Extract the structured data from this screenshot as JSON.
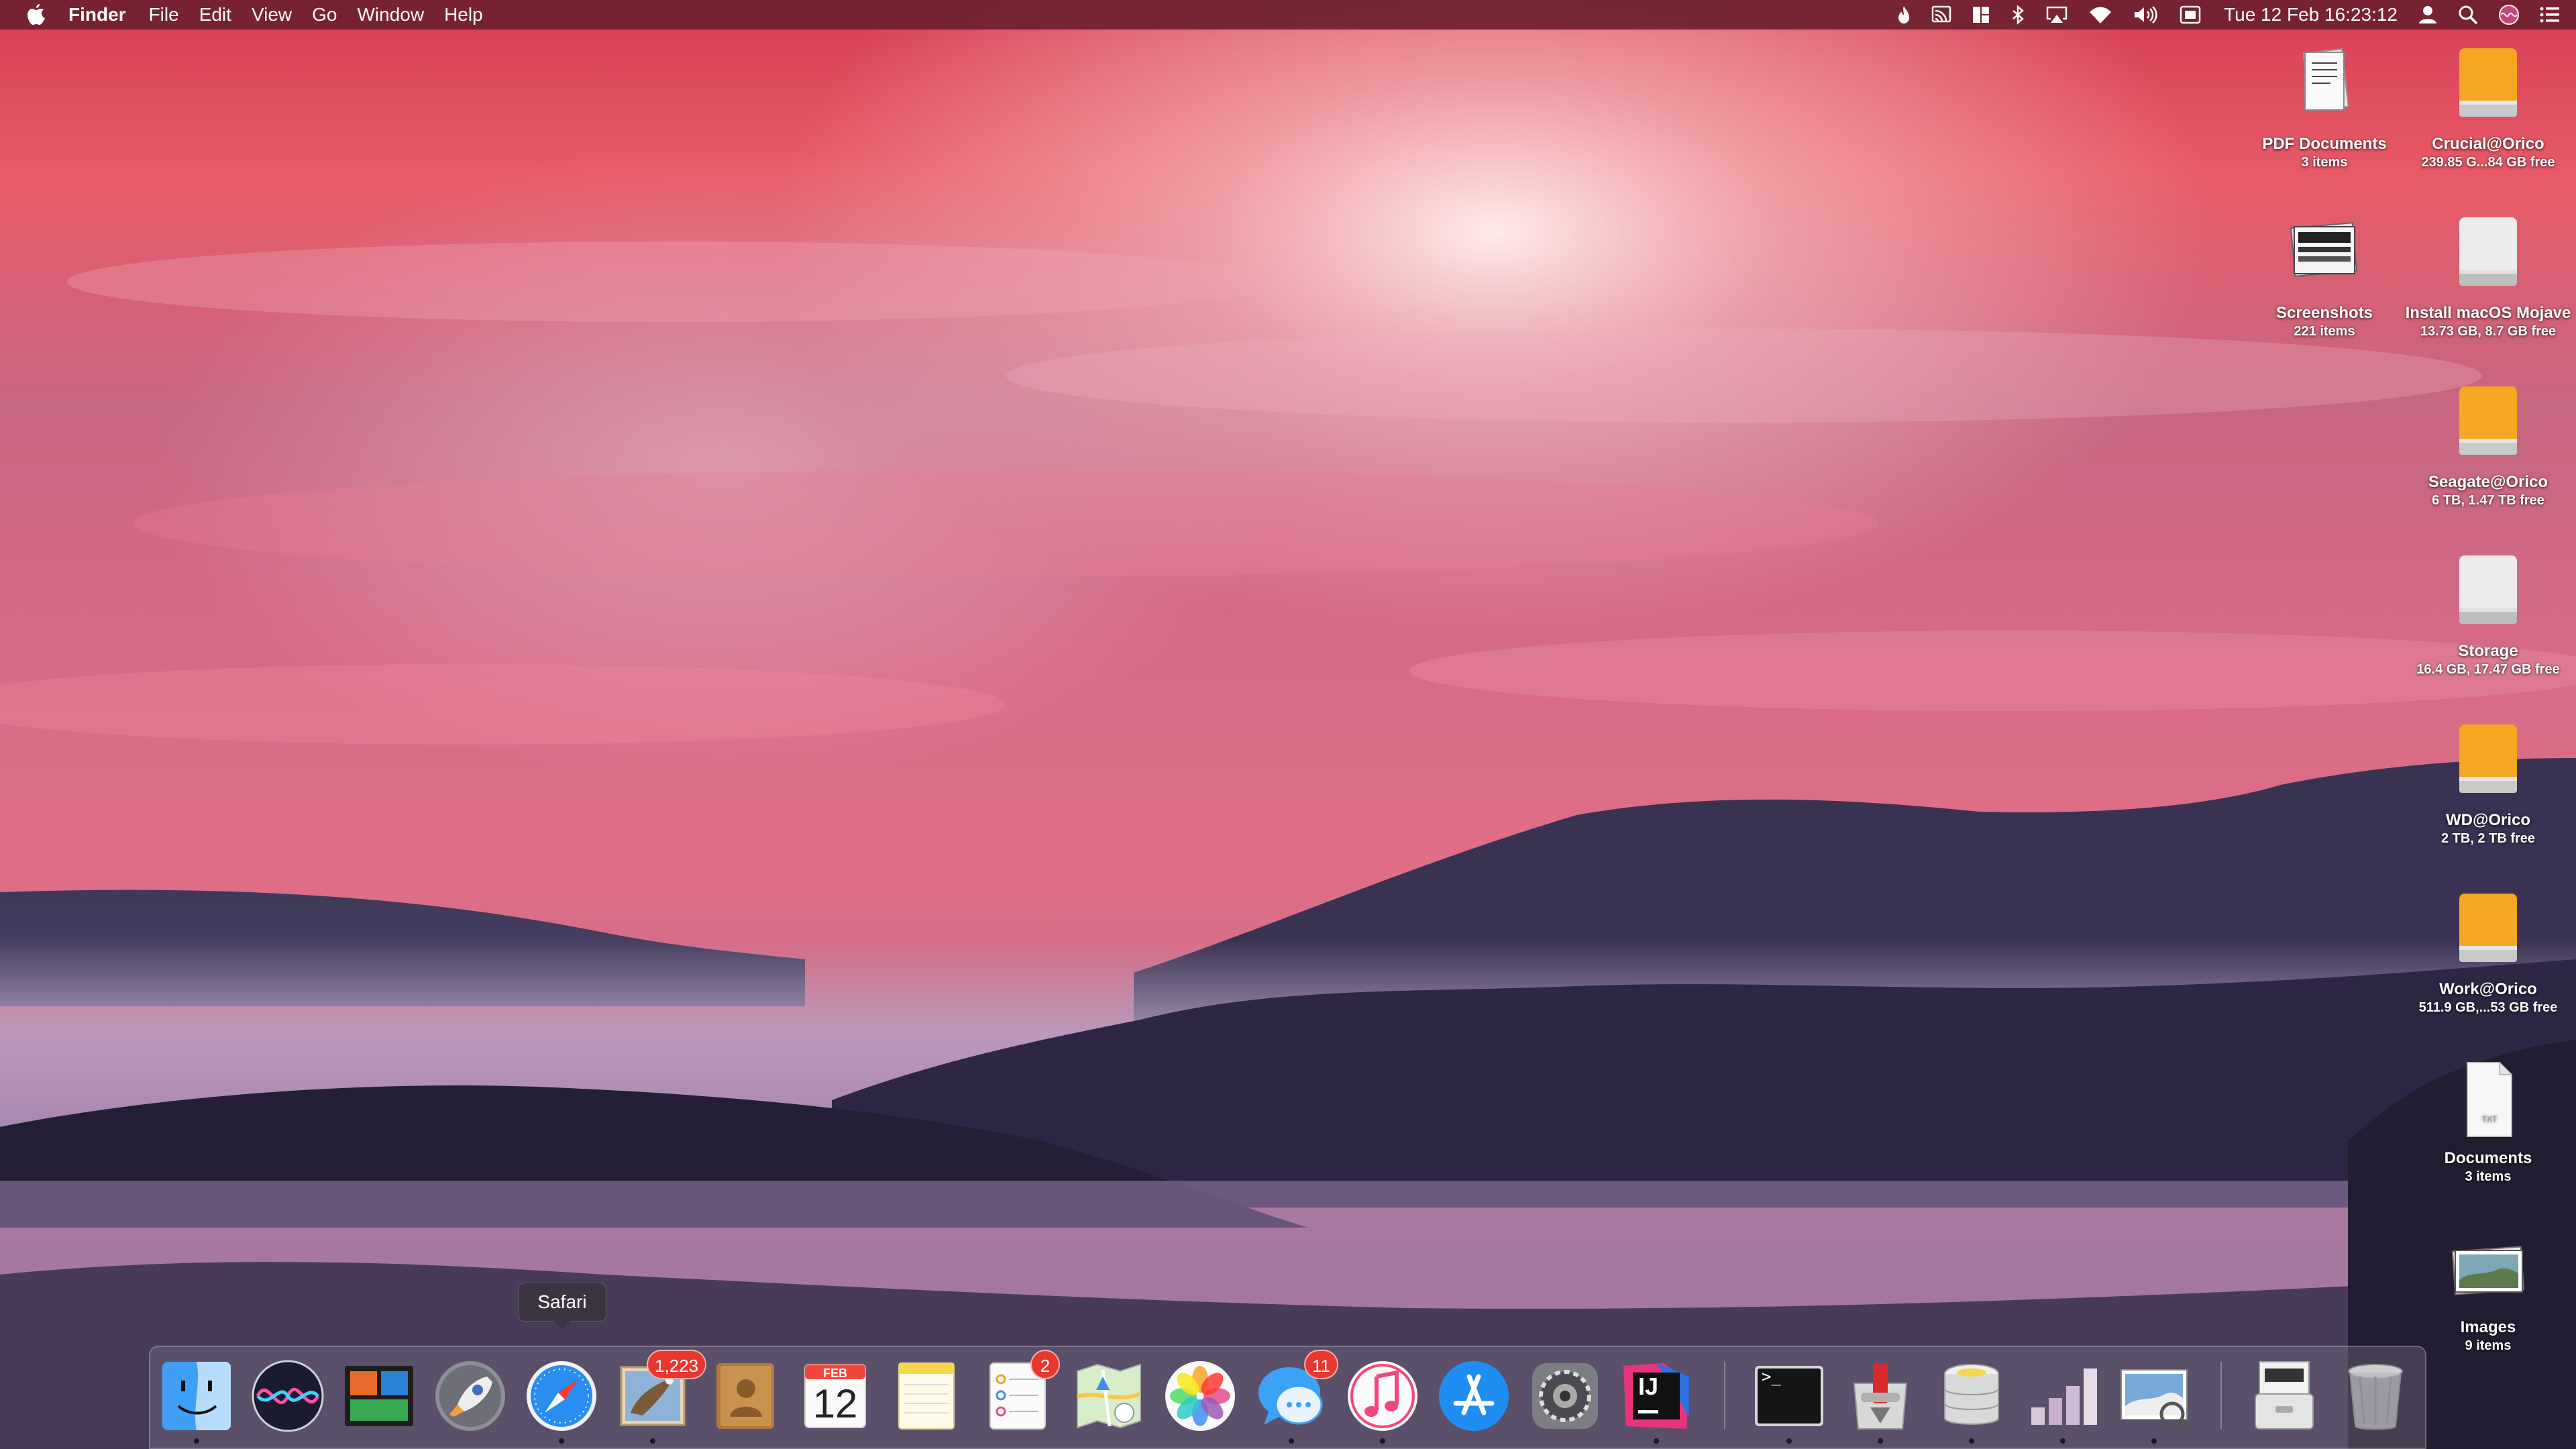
{
  "menubar": {
    "apple_icon": "apple-logo-icon",
    "app_name": "Finder",
    "menus": [
      "File",
      "Edit",
      "View",
      "Go",
      "Window",
      "Help"
    ],
    "status_icons": [
      "flame-icon",
      "cast-icon",
      "window-layout-icon",
      "bluetooth-icon",
      "airplay-icon",
      "wifi-icon",
      "volume-icon",
      "keyboard-input-icon"
    ],
    "clock": "Tue 12 Feb  16:23:12",
    "right_icons": [
      "user-icon",
      "spotlight-search-icon",
      "siri-icon",
      "notification-center-icon"
    ]
  },
  "desktop": {
    "items": [
      {
        "name": "PDF Documents",
        "info": "3 items",
        "icon": "pdf-stack-icon"
      },
      {
        "name": "Crucial@Orico",
        "info": "239.85 G...84 GB free",
        "icon": "orange-drive-icon"
      },
      {
        "name": "Screenshots",
        "info": "221 items",
        "icon": "screenshots-stack-icon"
      },
      {
        "name": "Install macOS Mojave",
        "info": "13.73 GB, 8.7 GB free",
        "icon": "white-drive-icon"
      },
      {
        "name": "Seagate@Orico",
        "info": "6 TB, 1.47 TB free",
        "icon": "orange-drive-icon"
      },
      {
        "name": "Storage",
        "info": "16.4 GB, 17.47 GB free",
        "icon": "white-drive-icon"
      },
      {
        "name": "WD@Orico",
        "info": "2 TB, 2 TB free",
        "icon": "orange-drive-icon"
      },
      {
        "name": "Work@Orico",
        "info": "511.9 GB,...53 GB free",
        "icon": "orange-drive-icon"
      },
      {
        "name": "Documents",
        "info": "3 items",
        "icon": "txt-document-icon"
      },
      {
        "name": "Images",
        "info": "9 items",
        "icon": "images-stack-icon"
      }
    ]
  },
  "dock": {
    "tooltip": "Safari",
    "items": [
      {
        "name": "Finder",
        "icon": "finder-icon",
        "running": true
      },
      {
        "name": "Siri",
        "icon": "siri-icon",
        "running": false
      },
      {
        "name": "Screen Manager",
        "icon": "screen-manager-icon",
        "running": false
      },
      {
        "name": "Launchpad",
        "icon": "launchpad-rocket-icon",
        "running": false
      },
      {
        "name": "Safari",
        "icon": "safari-compass-icon",
        "running": true
      },
      {
        "name": "Mail",
        "icon": "mail-eagle-icon",
        "running": true,
        "badge": "1,223"
      },
      {
        "name": "Contacts",
        "icon": "contacts-book-icon",
        "running": false
      },
      {
        "name": "Calendar",
        "icon": "calendar-icon",
        "running": false,
        "month": "FEB",
        "day": "12"
      },
      {
        "name": "Notes",
        "icon": "notes-icon",
        "running": false
      },
      {
        "name": "Reminders",
        "icon": "reminders-icon",
        "running": false,
        "badge": "2"
      },
      {
        "name": "Maps",
        "icon": "maps-icon",
        "running": false
      },
      {
        "name": "Photos",
        "icon": "photos-flower-icon",
        "running": false
      },
      {
        "name": "Messages",
        "icon": "messages-bubble-icon",
        "running": true,
        "badge": "11"
      },
      {
        "name": "iTunes",
        "icon": "itunes-music-icon",
        "running": true
      },
      {
        "name": "App Store",
        "icon": "app-store-icon",
        "running": false
      },
      {
        "name": "System Preferences",
        "icon": "system-preferences-gear-icon",
        "running": false
      },
      {
        "name": "IntelliJ IDEA",
        "icon": "intellij-idea-icon",
        "running": true,
        "text": "IJ"
      },
      {
        "name": "Terminal",
        "icon": "terminal-icon",
        "running": true,
        "text": ">_"
      },
      {
        "name": "Transmission",
        "icon": "transmission-icon",
        "running": true
      },
      {
        "name": "Sequel Pro",
        "icon": "database-stack-icon",
        "running": true
      },
      {
        "name": "Disk Utility Stats",
        "icon": "disk-bars-icon",
        "running": true
      },
      {
        "name": "Preview",
        "icon": "preview-photos-icon",
        "running": true
      },
      {
        "name": "Downloads Stack",
        "icon": "downloads-stack-icon",
        "running": false
      },
      {
        "name": "Trash",
        "icon": "trash-icon",
        "running": false
      }
    ]
  },
  "colors": {
    "menubar_bg": "#6e202e",
    "badge_red": "#e8372f",
    "drive_orange": "#f5a623"
  }
}
